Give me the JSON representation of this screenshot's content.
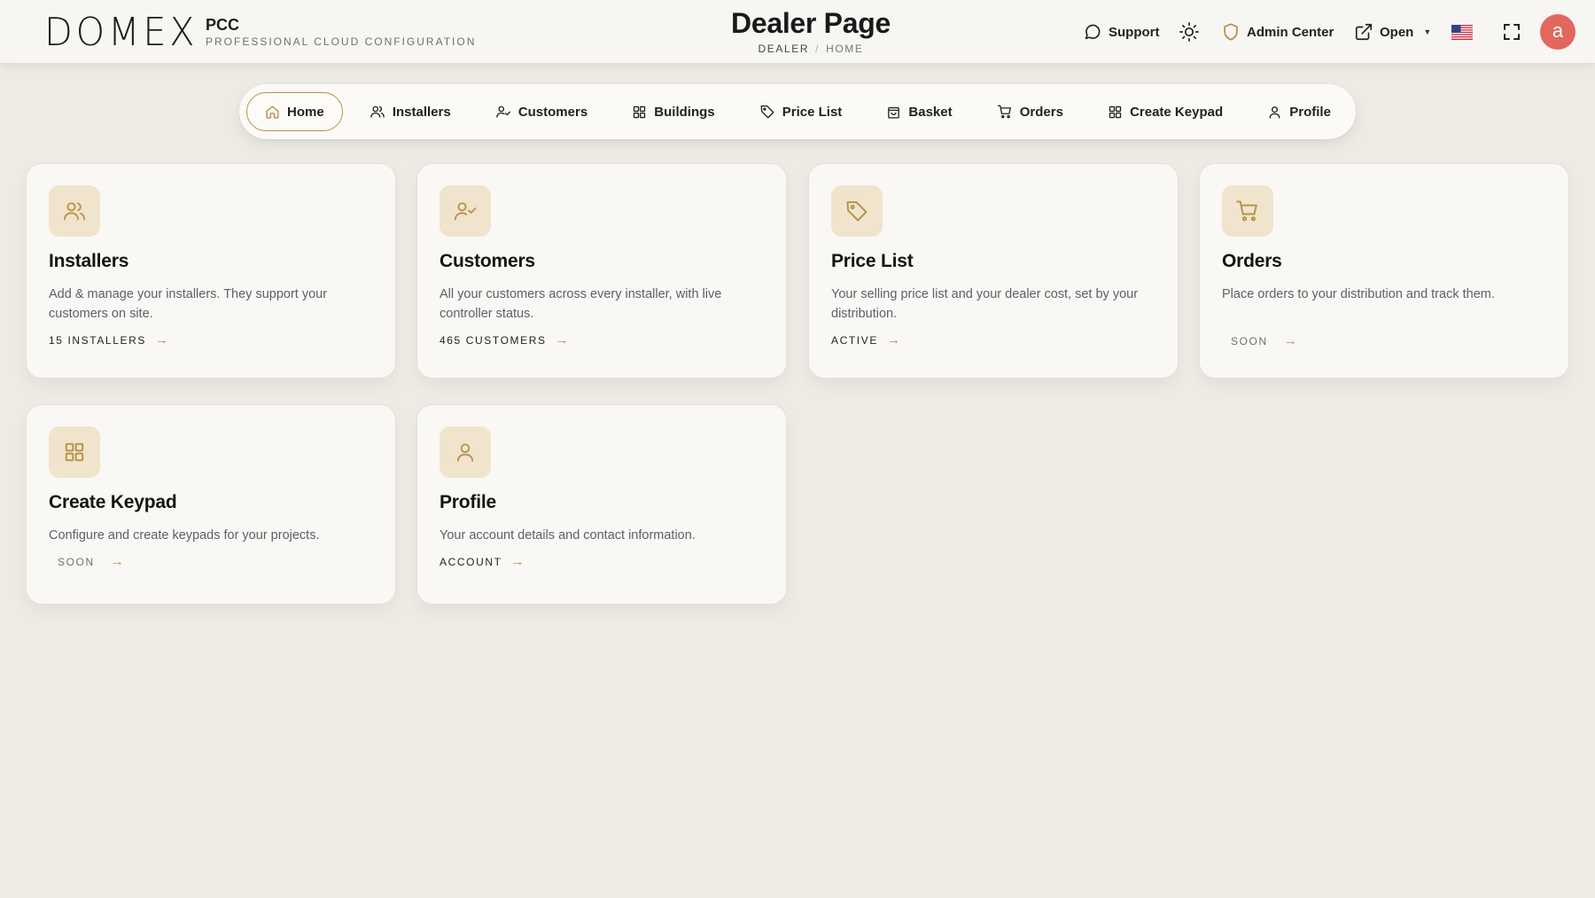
{
  "header": {
    "logo_text": "DOMEX",
    "brand_name": "PCC",
    "brand_subtitle": "PROFESSIONAL CLOUD CONFIGURATION",
    "page_title": "Dealer Page",
    "breadcrumb": [
      "DEALER",
      "HOME"
    ],
    "support_label": "Support",
    "admin_center_label": "Admin Center",
    "open_label": "Open",
    "avatar_initial": "a",
    "icons": [
      "chat-bubble-icon",
      "sun-icon",
      "shield-icon",
      "external-link-icon",
      "us-flag-icon",
      "fullscreen-icon"
    ]
  },
  "nav": {
    "tabs": [
      {
        "label": "Home",
        "icon": "home-icon",
        "active": true
      },
      {
        "label": "Installers",
        "icon": "users-icon"
      },
      {
        "label": "Customers",
        "icon": "user-check-icon"
      },
      {
        "label": "Buildings",
        "icon": "grid-icon"
      },
      {
        "label": "Price List",
        "icon": "tag-icon"
      },
      {
        "label": "Basket",
        "icon": "shopping-bag-icon"
      },
      {
        "label": "Orders",
        "icon": "cart-icon"
      },
      {
        "label": "Create Keypad",
        "icon": "grid-icon"
      },
      {
        "label": "Profile",
        "icon": "user-icon"
      }
    ]
  },
  "cards": [
    {
      "title": "Installers",
      "description": "Add & manage your installers. They support your customers on site.",
      "link": "15 INSTALLERS",
      "icon": "users-icon"
    },
    {
      "title": "Customers",
      "description": "All your customers across every installer, with live controller status.",
      "link": "465 CUSTOMERS",
      "icon": "user-check-icon"
    },
    {
      "title": "Price List",
      "description": "Your selling price list and your dealer cost, set by your distribution.",
      "link": "ACTIVE",
      "icon": "tag-icon"
    },
    {
      "title": "Orders",
      "description": "Place orders to your distribution and track them.",
      "link": "SOON",
      "icon": "cart-icon"
    },
    {
      "title": "Create Keypad",
      "description": "Configure and create keypads for your projects.",
      "link": "SOON",
      "icon": "grid-icon"
    },
    {
      "title": "Profile",
      "description": "Your account details and contact information.",
      "link": "ACCOUNT",
      "icon": "user-icon"
    }
  ],
  "colors": {
    "accent": "#b8924a",
    "icon_tile": "#f1e4cc",
    "avatar": "#e2675f",
    "background": "#eeebe4"
  }
}
